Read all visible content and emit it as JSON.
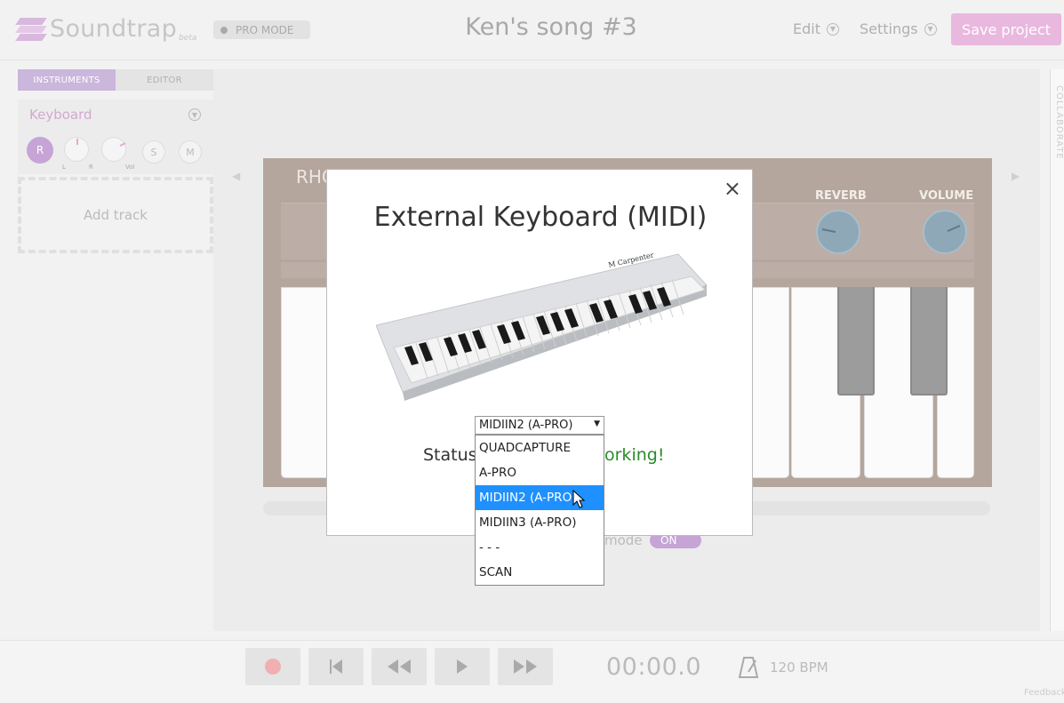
{
  "header": {
    "logo_text": "Soundtrap",
    "logo_beta": "beta",
    "pro_mode": "PRO MODE",
    "song_title": "Ken's song #3",
    "menu_edit": "Edit",
    "menu_settings": "Settings",
    "save_label": "Save project"
  },
  "left_panel": {
    "tabs": [
      "INSTRUMENTS",
      "EDITOR"
    ],
    "track": {
      "name": "Keyboard",
      "r_label": "R",
      "pan_left": "L",
      "pan_right": "R",
      "vol_label": "Vol",
      "solo_label": "S",
      "mute_label": "M"
    },
    "add_track": "Add track"
  },
  "instrument": {
    "title": "RHO",
    "reverb_label": "REVERB",
    "volume_label": "VOLUME"
  },
  "mode": {
    "label": "mode",
    "toggle": "ON"
  },
  "collab_label": "COLLABORATE",
  "modal": {
    "title": "External Keyboard (MIDI)",
    "close": "×",
    "status_label": "Status",
    "status_value": "orking!",
    "select": {
      "value": "MIDIIN2 (A-PRO)",
      "options": [
        "QUADCAPTURE",
        "A-PRO",
        "MIDIIN2 (A-PRO)",
        "MIDIIN3 (A-PRO)",
        "- - -",
        "SCAN"
      ],
      "selected_index": 2
    }
  },
  "transport": {
    "time": "00:00.0",
    "bpm": "120 BPM"
  },
  "feedback": "Feedback",
  "colors": {
    "accent": "#c6a4d6",
    "save": "#e9b8de",
    "selected": "#1e90ff",
    "status_ok": "#2a8c2a"
  }
}
